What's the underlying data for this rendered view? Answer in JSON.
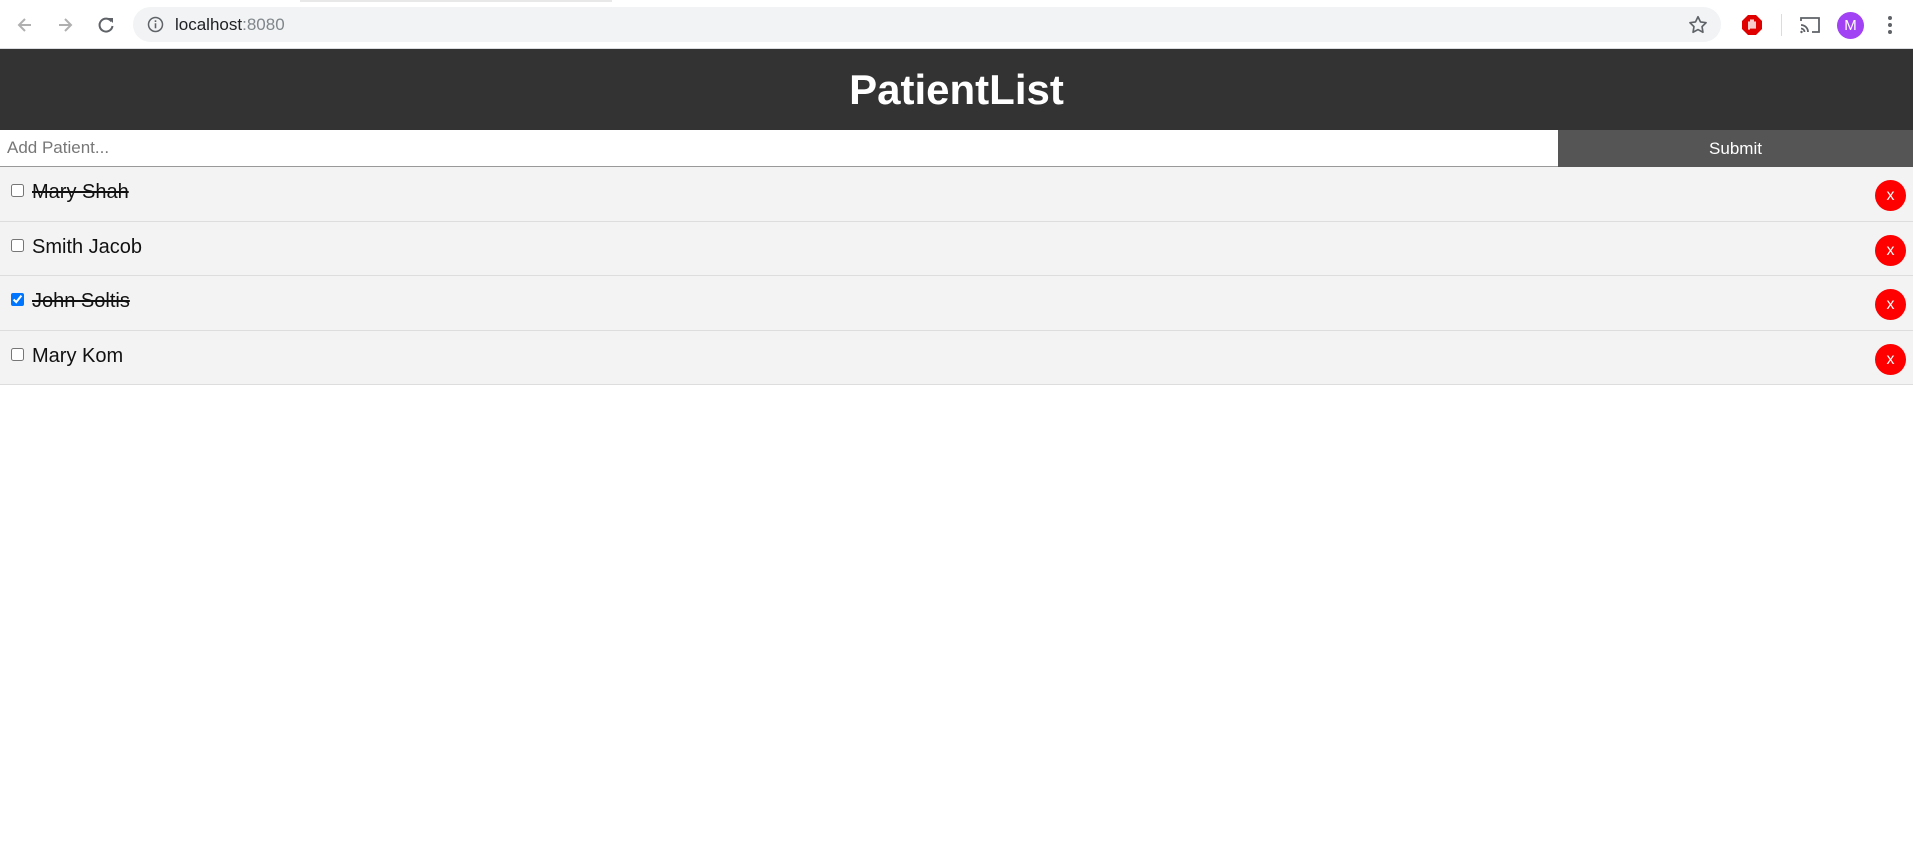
{
  "browser": {
    "url_host": "localhost",
    "url_port": ":8080",
    "avatar_initial": "M"
  },
  "app": {
    "title": "PatientList",
    "add_placeholder": "Add Patient...",
    "add_value": "",
    "submit_label": "Submit"
  },
  "patients": [
    {
      "name": "Mary Shah",
      "checked": false,
      "struck": true,
      "delete_label": "x"
    },
    {
      "name": "Smith Jacob",
      "checked": false,
      "struck": false,
      "delete_label": "x"
    },
    {
      "name": "John Soltis",
      "checked": true,
      "struck": true,
      "delete_label": "x"
    },
    {
      "name": "Mary Kom",
      "checked": false,
      "struck": false,
      "delete_label": "x"
    }
  ],
  "colors": {
    "header_bg": "#333333",
    "submit_bg": "#555555",
    "row_bg": "#f3f3f3",
    "delete_bg": "#ff0000",
    "avatar_bg": "#a142f4"
  }
}
